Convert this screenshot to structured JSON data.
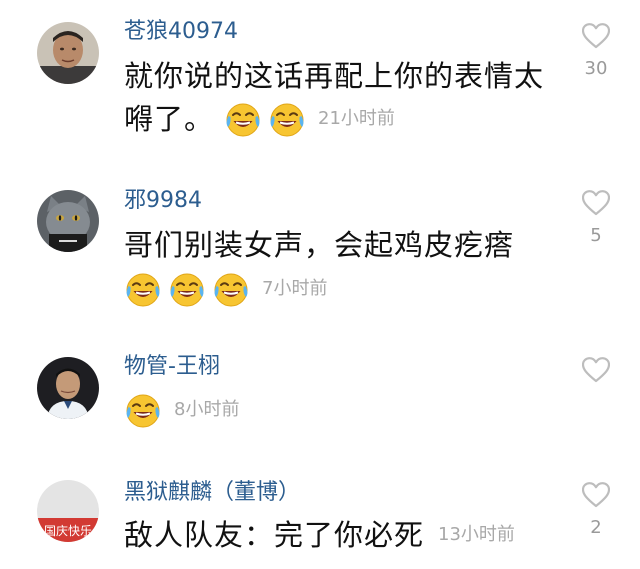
{
  "comments": [
    {
      "username": "苍狼40974",
      "lines": [
        "就你说的这话再配上你的表情太",
        "嘚了。"
      ],
      "timestamp": "21小时前",
      "likes": "30",
      "emoji_count": 2,
      "emoji_icon": "laughing-crying-emoji"
    },
    {
      "username": "邪9984",
      "lines": [
        "哥们别装女声，会起鸡皮疙瘩"
      ],
      "timestamp": "7小时前",
      "likes": "5",
      "emoji_count": 3,
      "emoji_icon": "laughing-crying-emoji"
    },
    {
      "username": "物管-王栩",
      "lines": [],
      "timestamp": "8小时前",
      "likes": "",
      "emoji_count": 1,
      "emoji_icon": "laughing-crying-emoji"
    },
    {
      "username": "黑狱麒麟（董博）",
      "lines": [
        "敌人队友：完了你必死"
      ],
      "timestamp": "13小时前",
      "likes": "2",
      "emoji_count": 0,
      "emoji_icon": ""
    }
  ],
  "avatar_badge": "国庆快乐",
  "colors": {
    "username": "#2c5d8f",
    "text": "#111111",
    "timestamp": "#a8a8a8",
    "like": "#bdbdbd"
  }
}
